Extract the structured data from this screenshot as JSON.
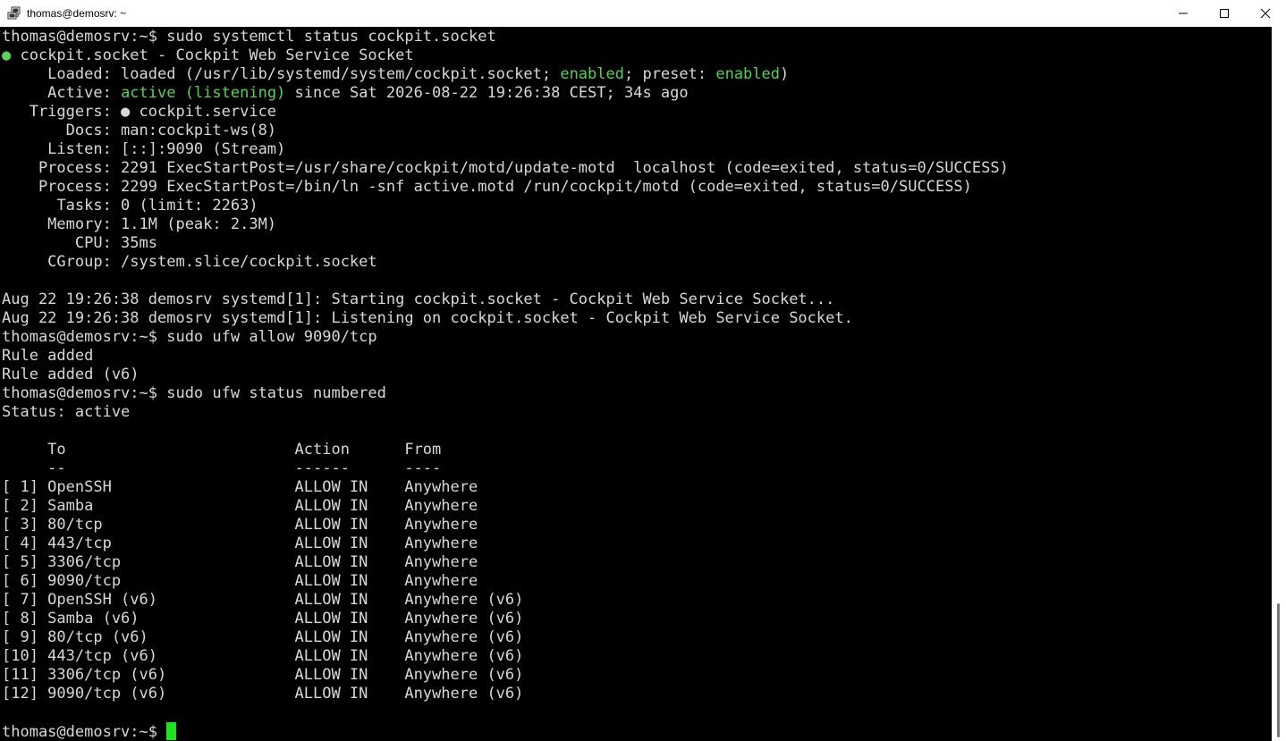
{
  "window": {
    "title": "thomas@demosrv: ~",
    "icon": "putty-icon"
  },
  "colors": {
    "terminal_bg": "#000000",
    "text": "#d8d8d8",
    "green": "#5ad05a",
    "cursor": "#22e022"
  },
  "terminal": {
    "lines": [
      {
        "segments": [
          {
            "t": "thomas@demosrv:~$ sudo systemctl status cockpit.socket"
          }
        ]
      },
      {
        "segments": [
          {
            "t": "●",
            "c": "green"
          },
          {
            "t": " cockpit.socket - Cockpit Web Service Socket"
          }
        ]
      },
      {
        "segments": [
          {
            "t": "     Loaded: loaded (/usr/lib/systemd/system/cockpit.socket; "
          },
          {
            "t": "enabled",
            "c": "green"
          },
          {
            "t": "; preset: "
          },
          {
            "t": "enabled",
            "c": "green"
          },
          {
            "t": ")"
          }
        ]
      },
      {
        "segments": [
          {
            "t": "     Active: "
          },
          {
            "t": "active (listening)",
            "c": "green"
          },
          {
            "t": " since Sat 2026-08-22 19:26:38 CEST; 34s ago"
          }
        ]
      },
      {
        "segments": [
          {
            "t": "   Triggers: ● cockpit.service"
          }
        ]
      },
      {
        "segments": [
          {
            "t": "       Docs: man:cockpit-ws(8)"
          }
        ]
      },
      {
        "segments": [
          {
            "t": "     Listen: [::]:9090 (Stream)"
          }
        ]
      },
      {
        "segments": [
          {
            "t": "    Process: 2291 ExecStartPost=/usr/share/cockpit/motd/update-motd  localhost (code=exited, status=0/SUCCESS)"
          }
        ]
      },
      {
        "segments": [
          {
            "t": "    Process: 2299 ExecStartPost=/bin/ln -snf active.motd /run/cockpit/motd (code=exited, status=0/SUCCESS)"
          }
        ]
      },
      {
        "segments": [
          {
            "t": "      Tasks: 0 (limit: 2263)"
          }
        ]
      },
      {
        "segments": [
          {
            "t": "     Memory: 1.1M (peak: 2.3M)"
          }
        ]
      },
      {
        "segments": [
          {
            "t": "        CPU: 35ms"
          }
        ]
      },
      {
        "segments": [
          {
            "t": "     CGroup: /system.slice/cockpit.socket"
          }
        ]
      },
      {
        "segments": [
          {
            "t": ""
          }
        ]
      },
      {
        "segments": [
          {
            "t": "Aug 22 19:26:38 demosrv systemd[1]: Starting cockpit.socket - Cockpit Web Service Socket..."
          }
        ]
      },
      {
        "segments": [
          {
            "t": "Aug 22 19:26:38 demosrv systemd[1]: Listening on cockpit.socket - Cockpit Web Service Socket."
          }
        ]
      },
      {
        "segments": [
          {
            "t": "thomas@demosrv:~$ sudo ufw allow 9090/tcp"
          }
        ]
      },
      {
        "segments": [
          {
            "t": "Rule added"
          }
        ]
      },
      {
        "segments": [
          {
            "t": "Rule added (v6)"
          }
        ]
      },
      {
        "segments": [
          {
            "t": "thomas@demosrv:~$ sudo ufw status numbered"
          }
        ]
      },
      {
        "segments": [
          {
            "t": "Status: active"
          }
        ]
      },
      {
        "segments": [
          {
            "t": ""
          }
        ]
      },
      {
        "segments": [
          {
            "t": "     To                         Action      From"
          }
        ]
      },
      {
        "segments": [
          {
            "t": "     --                         ------      ----"
          }
        ]
      },
      {
        "segments": [
          {
            "t": "[ 1] OpenSSH                    ALLOW IN    Anywhere"
          }
        ]
      },
      {
        "segments": [
          {
            "t": "[ 2] Samba                      ALLOW IN    Anywhere"
          }
        ]
      },
      {
        "segments": [
          {
            "t": "[ 3] 80/tcp                     ALLOW IN    Anywhere"
          }
        ]
      },
      {
        "segments": [
          {
            "t": "[ 4] 443/tcp                    ALLOW IN    Anywhere"
          }
        ]
      },
      {
        "segments": [
          {
            "t": "[ 5] 3306/tcp                   ALLOW IN    Anywhere"
          }
        ]
      },
      {
        "segments": [
          {
            "t": "[ 6] 9090/tcp                   ALLOW IN    Anywhere"
          }
        ]
      },
      {
        "segments": [
          {
            "t": "[ 7] OpenSSH (v6)               ALLOW IN    Anywhere (v6)"
          }
        ]
      },
      {
        "segments": [
          {
            "t": "[ 8] Samba (v6)                 ALLOW IN    Anywhere (v6)"
          }
        ]
      },
      {
        "segments": [
          {
            "t": "[ 9] 80/tcp (v6)                ALLOW IN    Anywhere (v6)"
          }
        ]
      },
      {
        "segments": [
          {
            "t": "[10] 443/tcp (v6)               ALLOW IN    Anywhere (v6)"
          }
        ]
      },
      {
        "segments": [
          {
            "t": "[11] 3306/tcp (v6)              ALLOW IN    Anywhere (v6)"
          }
        ]
      },
      {
        "segments": [
          {
            "t": "[12] 9090/tcp (v6)              ALLOW IN    Anywhere (v6)"
          }
        ]
      },
      {
        "segments": [
          {
            "t": ""
          }
        ]
      },
      {
        "segments": [
          {
            "t": "thomas@demosrv:~$ "
          }
        ],
        "cursor": true
      }
    ]
  }
}
